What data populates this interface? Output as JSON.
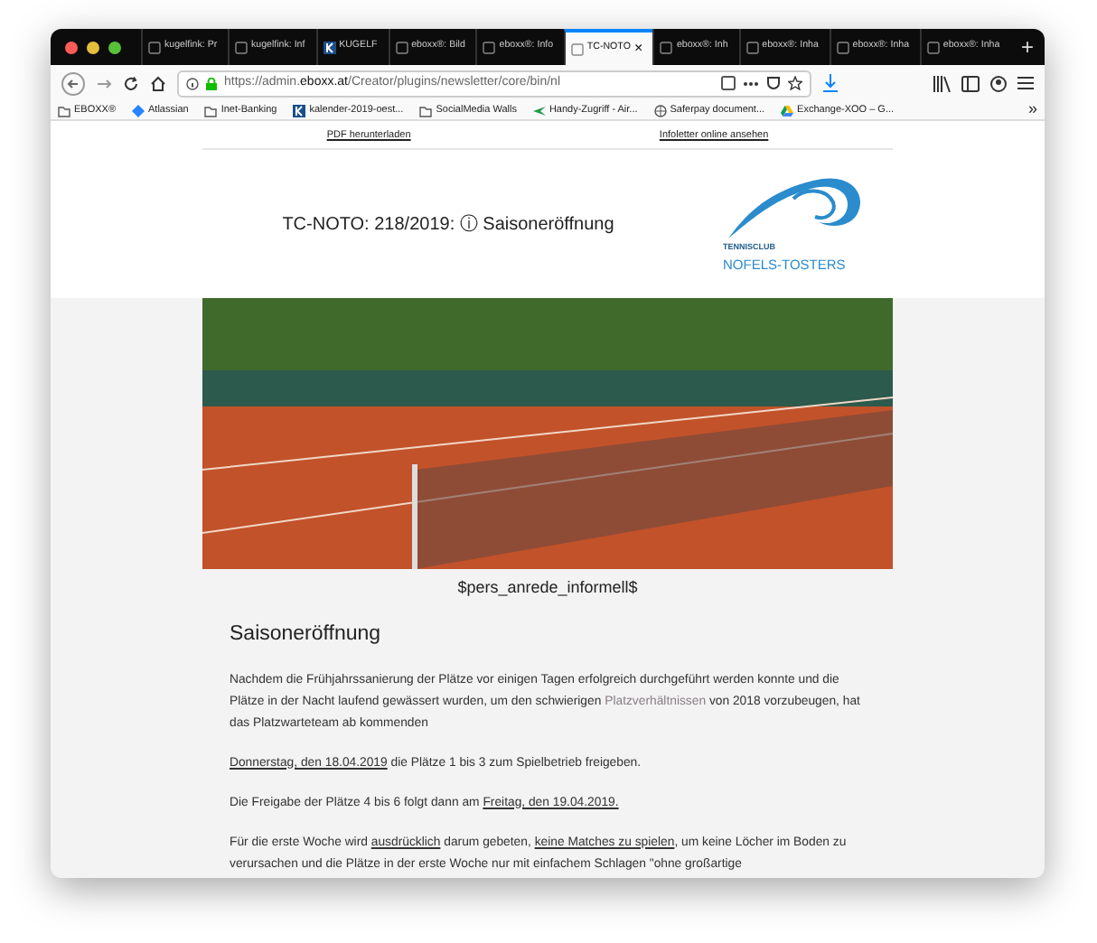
{
  "tabs": [
    {
      "label": "kugelfink: Pr",
      "kind": "page",
      "selected": false
    },
    {
      "label": "kugelfink: Inf",
      "kind": "page",
      "selected": false
    },
    {
      "label": "KUGELF",
      "kind": "logo",
      "selected": false
    },
    {
      "label": "eboxx®: Bild",
      "kind": "page",
      "selected": false
    },
    {
      "label": "eboxx®: Info",
      "kind": "page",
      "selected": false
    },
    {
      "label": "TC-NOTO",
      "kind": "page",
      "selected": true,
      "close": "×"
    },
    {
      "label": "eboxx®: Inh",
      "kind": "page",
      "selected": false
    },
    {
      "label": "eboxx®: Inha",
      "kind": "page",
      "selected": false
    },
    {
      "label": "eboxx®: Inha",
      "kind": "page",
      "selected": false
    },
    {
      "label": "eboxx®: Inha",
      "kind": "page",
      "selected": false
    }
  ],
  "new_tab": "+",
  "bookmarks_more": "»",
  "address": {
    "prefix": "https://admin.",
    "domain": "eboxx.at",
    "path": "/Creator/plugins/newsletter/core/bin/nl"
  },
  "bookmarks": [
    {
      "label": "EBOXX®",
      "kind": "folder"
    },
    {
      "label": "Atlassian",
      "kind": "diamond"
    },
    {
      "label": "Inet-Banking",
      "kind": "folder"
    },
    {
      "label": "kalender-2019-oest...",
      "kind": "logo"
    },
    {
      "label": "SocialMedia Walls",
      "kind": "folder"
    },
    {
      "label": "Handy-Zugriff - Air...",
      "kind": "plane"
    },
    {
      "label": "Saferpay document...",
      "kind": "globe"
    },
    {
      "label": "Exchange-XOO – G...",
      "kind": "drive"
    }
  ],
  "top_links": [
    "PDF herunterladen",
    "Infoletter online ansehen"
  ],
  "newsletter_title": "TC-NOTO: 218/2019: ⓘ Saisoneröffnung",
  "logo": {
    "line_1": "TENNISCLUB",
    "line_2": "NOFELS-TOSTERS"
  },
  "salutation": "$pers_anrede_informell$",
  "heading": "Saisoneröffnung",
  "paragraphs": [
    [
      {
        "text": "Nachdem die Frühjahrssanierung der Plätze vor einigen Tagen erfolgreich durchgeführt werden konnte und die Plätze in der Nacht laufend gewässert wurden, um den schwierigen ",
        "kind": "plain"
      },
      {
        "text": "Platzverhältnissen",
        "kind": "muted"
      },
      {
        "text": " von 2018 vorzubeugen, hat das Platzwarteteam ab kommenden",
        "kind": "plain"
      }
    ],
    [
      {
        "text": "Donnerstag, den 18.04.2019",
        "kind": "link"
      },
      {
        "text": " die Plätze 1 bis 3 zum Spielbetrieb freigeben.",
        "kind": "plain"
      }
    ],
    [
      {
        "text": "Die Freigabe der Plätze 4 bis 6 folgt dann am ",
        "kind": "plain"
      },
      {
        "text": "Freitag, den 19.04.2019.",
        "kind": "link"
      }
    ],
    [
      {
        "text": "Für die erste Woche wird ",
        "kind": "plain"
      },
      {
        "text": "ausdrücklich",
        "kind": "link"
      },
      {
        "text": " darum gebeten, ",
        "kind": "plain"
      },
      {
        "text": "keine Matches zu spielen",
        "kind": "link"
      },
      {
        "text": ", um keine Löcher im Boden zu verursachen und die Plätze in der erste Woche nur mit einfachem Schlagen \"ohne großartige",
        "kind": "plain"
      }
    ]
  ]
}
